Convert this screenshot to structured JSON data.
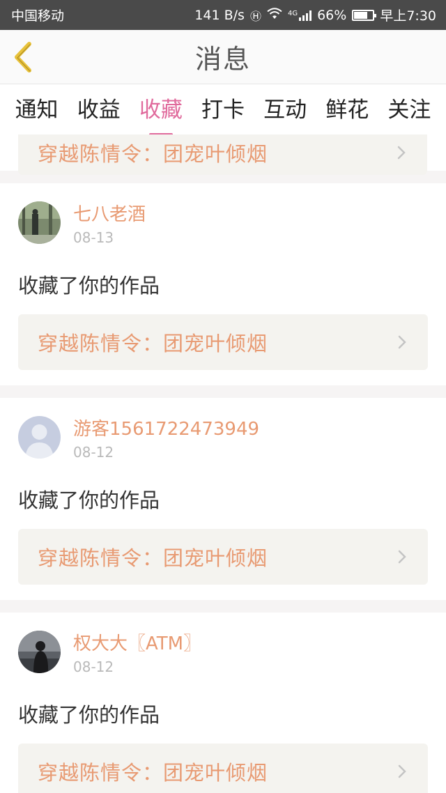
{
  "status_bar": {
    "carrier": "中国移动",
    "speed": "141 B/s",
    "network": "4G",
    "battery": "66%",
    "time": "早上7:30"
  },
  "header": {
    "title": "消息"
  },
  "tabs": [
    {
      "label": "通知",
      "active": false
    },
    {
      "label": "收益",
      "active": false
    },
    {
      "label": "收藏",
      "active": true
    },
    {
      "label": "打卡",
      "active": false
    },
    {
      "label": "互动",
      "active": false
    },
    {
      "label": "鲜花",
      "active": false
    },
    {
      "label": "关注",
      "active": false
    }
  ],
  "partial_card": {
    "work_title": "穿越陈情令：团宠叶倾烟"
  },
  "messages": [
    {
      "username": "七八老酒",
      "date": "08-13",
      "action": "收藏了你的作品",
      "work_title": "穿越陈情令：团宠叶倾烟"
    },
    {
      "username": "游客1561722473949",
      "date": "08-12",
      "action": "收藏了你的作品",
      "work_title": "穿越陈情令：团宠叶倾烟"
    },
    {
      "username": "权大大〖ATM〗",
      "date": "08-12",
      "action": "收藏了你的作品",
      "work_title": "穿越陈情令：团宠叶倾烟"
    }
  ],
  "colors": {
    "accent": "#e06a9c",
    "username": "#e89a72",
    "back_arrow": "#e8c23a"
  },
  "icons": {
    "back": "chevron-left-icon",
    "link": "chevron-right-icon"
  }
}
